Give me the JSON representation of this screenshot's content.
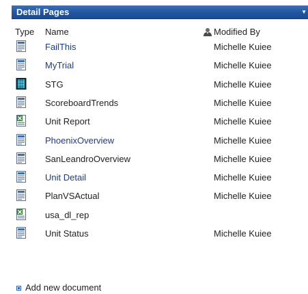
{
  "webpart": {
    "title": "Detail Pages",
    "menu_glyph": "▼"
  },
  "columns": {
    "type": "Type",
    "name": "Name",
    "modified_by": "Modified By"
  },
  "items": [
    {
      "name": "FailThis",
      "modified_by": "Michelle Kuiee",
      "icon": "scorecard-page-icon",
      "name_style": "link"
    },
    {
      "name": "MyTrial",
      "modified_by": "Michelle Kuiee",
      "icon": "scorecard-page-icon",
      "name_style": "link"
    },
    {
      "name": "STG",
      "modified_by": "Michelle Kuiee",
      "icon": "cube-file-icon",
      "name_style": "dark"
    },
    {
      "name": "ScoreboardTrends",
      "modified_by": "Michelle Kuiee",
      "icon": "scorecard-page-icon",
      "name_style": "dark"
    },
    {
      "name": "Unit Report",
      "modified_by": "Michelle Kuiee",
      "icon": "excel-report-icon",
      "name_style": "dark"
    },
    {
      "name": "PhoenixOverview",
      "modified_by": "Michelle Kuiee",
      "icon": "scorecard-page-icon",
      "name_style": "link"
    },
    {
      "name": "SanLeandroOverview",
      "modified_by": "Michelle Kuiee",
      "icon": "scorecard-page-icon",
      "name_style": "dark"
    },
    {
      "name": "Unit Detail",
      "modified_by": "Michelle Kuiee",
      "icon": "scorecard-page-icon",
      "name_style": "link"
    },
    {
      "name": "PlanVSActual",
      "modified_by": "Michelle Kuiee",
      "icon": "scorecard-page-icon",
      "name_style": "dark"
    },
    {
      "name": "usa_dl_rep",
      "modified_by": "",
      "icon": "excel-report-icon",
      "name_style": "dark"
    },
    {
      "name": "Unit Status",
      "modified_by": "Michelle Kuiee",
      "icon": "scorecard-page-icon",
      "name_style": "dark"
    }
  ],
  "footer": {
    "add_label": "Add new document"
  },
  "colors": {
    "header": "#21569f",
    "link": "#1a3c8c",
    "text": "#1f1f1f"
  }
}
